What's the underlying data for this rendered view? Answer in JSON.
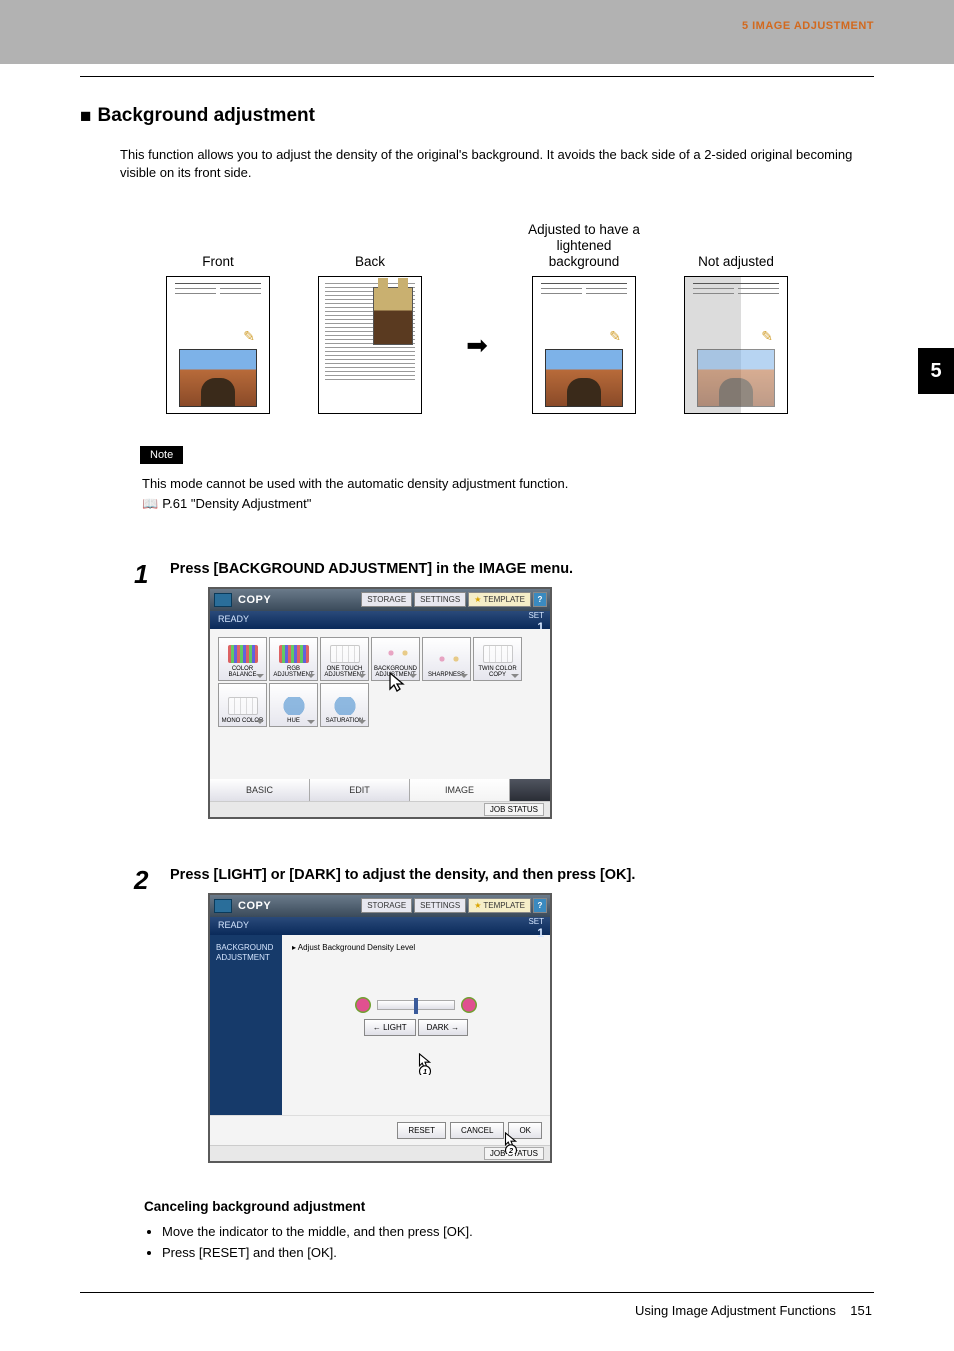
{
  "header": {
    "chapter": "5 IMAGE ADJUSTMENT"
  },
  "chapter_tab": "5",
  "section": {
    "title": "Background adjustment",
    "intro": "This function allows you to adjust the density of the original's background. It avoids the back side of a 2-sided original becoming visible on its front side."
  },
  "diagram": {
    "front": "Front",
    "back": "Back",
    "adjusted": "Adjusted to have a lightened background",
    "not_adjusted": "Not adjusted"
  },
  "note": {
    "label": "Note",
    "line1": "This mode cannot be used with the automatic density adjustment function.",
    "ref": "P.61 \"Density Adjustment\""
  },
  "steps": {
    "s1": {
      "num": "1",
      "title": "Press [BACKGROUND ADJUSTMENT] in the IMAGE menu.",
      "lcd": {
        "title": "COPY",
        "topbtns": {
          "storage": "STORAGE",
          "settings": "SETTINGS",
          "template": "TEMPLATE",
          "help": "?"
        },
        "ready": "READY",
        "set": "SET",
        "one": "1",
        "buttons": {
          "b1": "COLOR BALANCE",
          "b2": "RGB ADJUSTMENT",
          "b3": "ONE TOUCH ADJUSTMENT",
          "b4": "BACKGROUND ADJUSTMENT",
          "b5": "SHARPNESS",
          "b6": "TWIN COLOR COPY",
          "b7": "MONO COLOR",
          "b8": "HUE",
          "b9": "SATURATION"
        },
        "tabs": {
          "basic": "BASIC",
          "edit": "EDIT",
          "image": "IMAGE"
        },
        "jobstatus": "JOB STATUS"
      }
    },
    "s2": {
      "num": "2",
      "title": "Press [LIGHT] or [DARK] to adjust the density, and then press [OK].",
      "lcd": {
        "title": "COPY",
        "topbtns": {
          "storage": "STORAGE",
          "settings": "SETTINGS",
          "template": "TEMPLATE",
          "help": "?"
        },
        "ready": "READY",
        "set": "SET",
        "one": "1",
        "side_t": "BACKGROUND ADJUSTMENT",
        "instr": "▸ Adjust Background Density Level",
        "light_btn": "← LIGHT",
        "dark_btn": "DARK →",
        "reset": "RESET",
        "cancel": "CANCEL",
        "ok": "OK",
        "jobstatus": "JOB STATUS",
        "callout1": "1",
        "callout2": "2"
      }
    }
  },
  "cancel": {
    "h": "Canceling background adjustment",
    "b1": "Move the indicator to the middle, and then press [OK].",
    "b2": "Press [RESET] and then [OK]."
  },
  "footer": {
    "text": "Using Image Adjustment Functions",
    "page": "151"
  }
}
